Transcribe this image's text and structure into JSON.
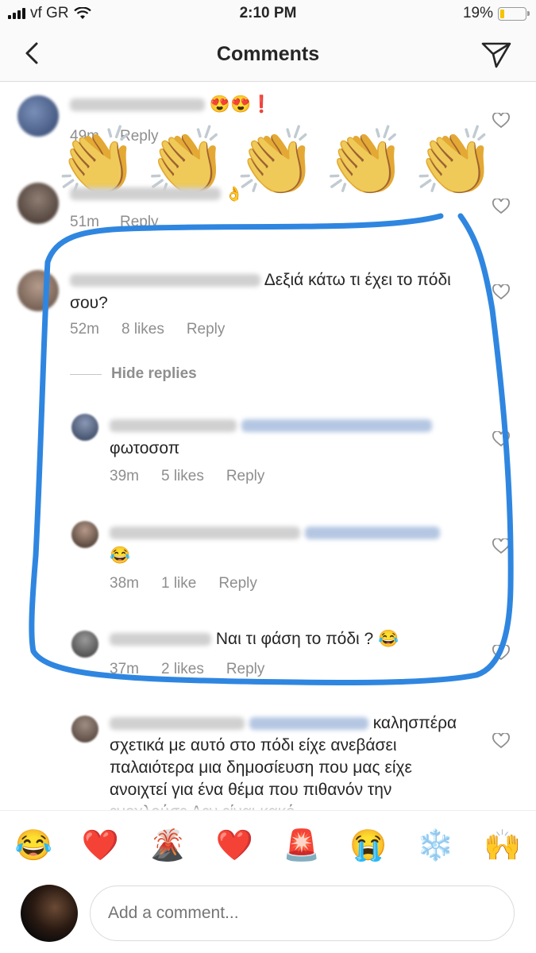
{
  "status_bar": {
    "carrier": "vf GR",
    "time": "2:10 PM",
    "battery": "19%",
    "battery_level": 0.19
  },
  "header": {
    "title": "Comments"
  },
  "comments": [
    {
      "text": "😍😍❗",
      "time": "49m",
      "reply": "Reply"
    },
    {
      "text": "👌",
      "time": "51m",
      "reply": "Reply"
    },
    {
      "text": "Δεξιά κάτω τι έχει το πόδι σου?",
      "time": "52m",
      "likes": "8 likes",
      "reply": "Reply"
    }
  ],
  "overlay": {
    "claps": "👏👏👏👏👏"
  },
  "hide_replies": "Hide replies",
  "replies": [
    {
      "text": "φωτοσοπ",
      "time": "39m",
      "likes": "5 likes",
      "reply": "Reply"
    },
    {
      "text": "😂",
      "time": "38m",
      "likes": "1 like",
      "reply": "Reply"
    },
    {
      "text": "Ναι τι φάση το πόδι ? 😂",
      "time": "37m",
      "likes": "2 likes",
      "reply": "Reply"
    },
    {
      "text": "καλησπέρα σχετικά με αυτό στο πόδι είχε ανεβάσει παλαιότερα μια δημοσίευση που μας είχε ανοιχτεί για ένα θέμα που πιθανόν την ενοχλούσε Δεν είναι κακό"
    }
  ],
  "emoji_bar": [
    "😂",
    "❤️",
    "🌋",
    "❤️",
    "🚨",
    "😭",
    "❄️",
    "🙌"
  ],
  "composer": {
    "placeholder": "Add a comment..."
  },
  "colors": {
    "annotation": "#2f86e0",
    "muted": "#8e8e8e"
  }
}
